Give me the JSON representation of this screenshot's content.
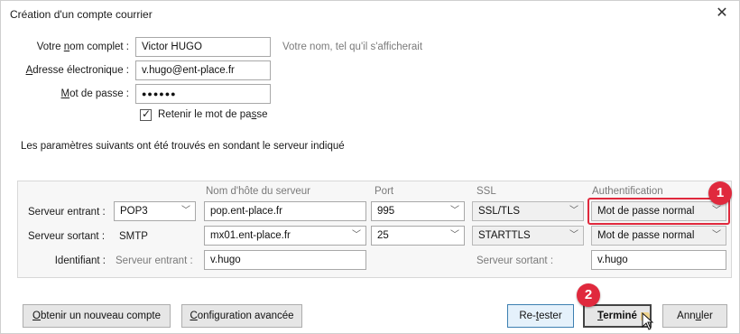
{
  "window": {
    "title": "Création d'un compte courrier",
    "close_glyph": "✕"
  },
  "account": {
    "name_label_pre": "Votre ",
    "name_label_u": "n",
    "name_label_post": "om complet :",
    "name_value": "Victor HUGO",
    "name_hint": "Votre nom, tel qu'il s'afficherait",
    "email_label_u": "A",
    "email_label_post": "dresse électronique :",
    "email_value": "v.hugo@ent-place.fr",
    "password_label_pre": "",
    "password_label_u": "M",
    "password_label_post": "ot de passe :",
    "password_value": "●●●●●●",
    "remember_checked": true,
    "remember_label_pre": "Retenir le mot de pa",
    "remember_label_u": "s",
    "remember_label_post": "se"
  },
  "info_text": "Les paramètres suivants ont été trouvés en sondant le serveur indiqué",
  "server_table": {
    "headers": {
      "hostname": "Nom d'hôte du serveur",
      "port": "Port",
      "ssl": "SSL",
      "auth": "Authentification"
    },
    "incoming": {
      "label": "Serveur entrant :",
      "protocol": "POP3",
      "hostname": "pop.ent-place.fr",
      "port": "995",
      "ssl": "SSL/TLS",
      "auth": "Mot de passe normal"
    },
    "outgoing": {
      "label": "Serveur sortant :",
      "protocol": "SMTP",
      "hostname": "mx01.ent-place.fr",
      "port": "25",
      "ssl": "STARTTLS",
      "auth": "Mot de passe normal"
    },
    "identifier": {
      "label": "Identifiant :",
      "incoming_label": "Serveur entrant :",
      "incoming_value": "v.hugo",
      "outgoing_label": "Serveur sortant :",
      "outgoing_value": "v.hugo"
    }
  },
  "buttons": {
    "new_account_u": "O",
    "new_account_post": "btenir un nouveau compte",
    "advanced_u": "C",
    "advanced_post": "onfiguration avancée",
    "retest_pre": "Re-",
    "retest_u": "t",
    "retest_post": "ester",
    "done_u": "T",
    "done_post": "erminé",
    "cancel_pre": "Ann",
    "cancel_u": "u",
    "cancel_post": "ler"
  },
  "annotations": {
    "badge1": "1",
    "badge2": "2"
  },
  "colors": {
    "annotation_red": "#e0293d",
    "focus_blue": "#3c7fb1"
  }
}
